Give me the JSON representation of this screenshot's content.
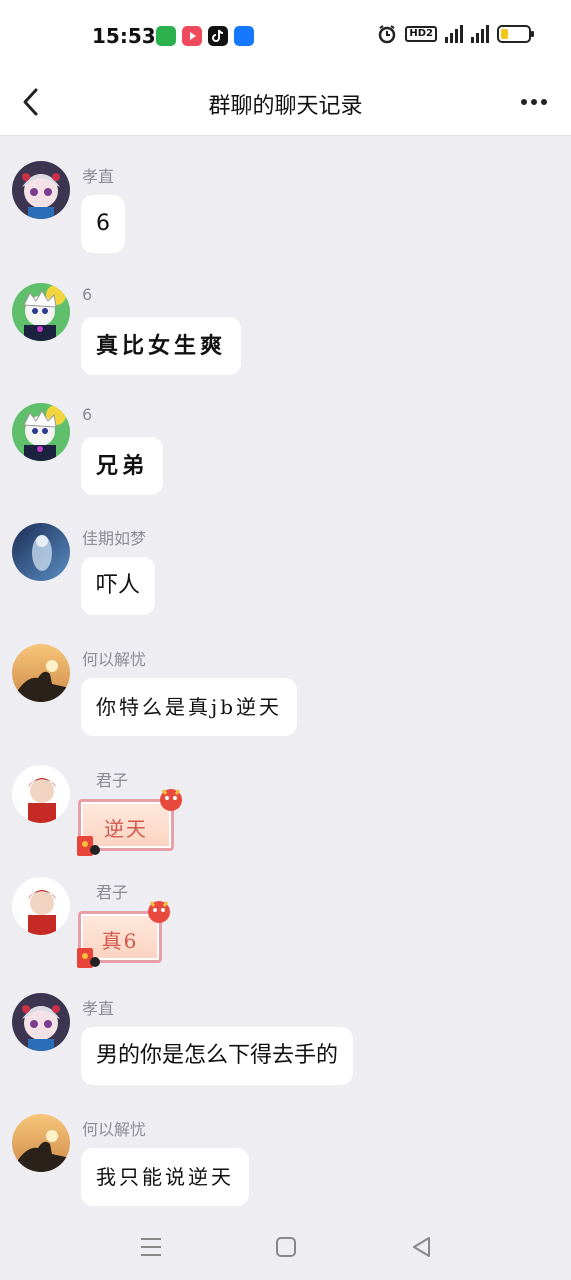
{
  "status_bar": {
    "time": "15:53",
    "app_icons": [
      {
        "name": "app-icon-green",
        "color": "#2bb24c"
      },
      {
        "name": "app-icon-red",
        "color": "#f04a5d"
      },
      {
        "name": "app-icon-tiktok",
        "color": "#111111"
      },
      {
        "name": "app-icon-alipay",
        "color": "#1677ff"
      }
    ],
    "hd_label": "HD2",
    "signal_label_1": "4G",
    "signal_label_2": "4G",
    "battery_level": 0.25,
    "battery_color": "#f5c518"
  },
  "header": {
    "title": "群聊的聊天记录",
    "back_icon": "chevron-left-icon",
    "more_icon": "more-horizontal-icon"
  },
  "messages": [
    {
      "sender": "孝直",
      "text": "6",
      "type": "text",
      "style": "normal"
    },
    {
      "sender": "6",
      "text": "真比女生爽",
      "type": "text",
      "style": "hand"
    },
    {
      "sender": "6",
      "text": "兄弟",
      "type": "text",
      "style": "hand"
    },
    {
      "sender": "佳期如梦",
      "text": "吓人",
      "type": "text",
      "style": "normal"
    },
    {
      "sender": "何以解忧",
      "text": "你特么是真jb逆天",
      "type": "text",
      "style": "hand2"
    },
    {
      "sender": "君子",
      "text": "逆天",
      "type": "sticker",
      "style": "sticker"
    },
    {
      "sender": "君子",
      "text": "真6",
      "type": "sticker",
      "style": "sticker"
    },
    {
      "sender": "孝直",
      "text": "男的你是怎么下得去手的",
      "type": "text",
      "style": "normal"
    },
    {
      "sender": "何以解忧",
      "text": "我只能说逆天",
      "type": "text",
      "style": "hand2"
    }
  ],
  "nav_bar": {
    "menu_icon": "menu-icon",
    "home_icon": "home-square-icon",
    "back_icon": "back-triangle-icon"
  },
  "colors": {
    "background": "#ededf2",
    "bubble": "#ffffff",
    "name_text": "#8c8c92"
  }
}
